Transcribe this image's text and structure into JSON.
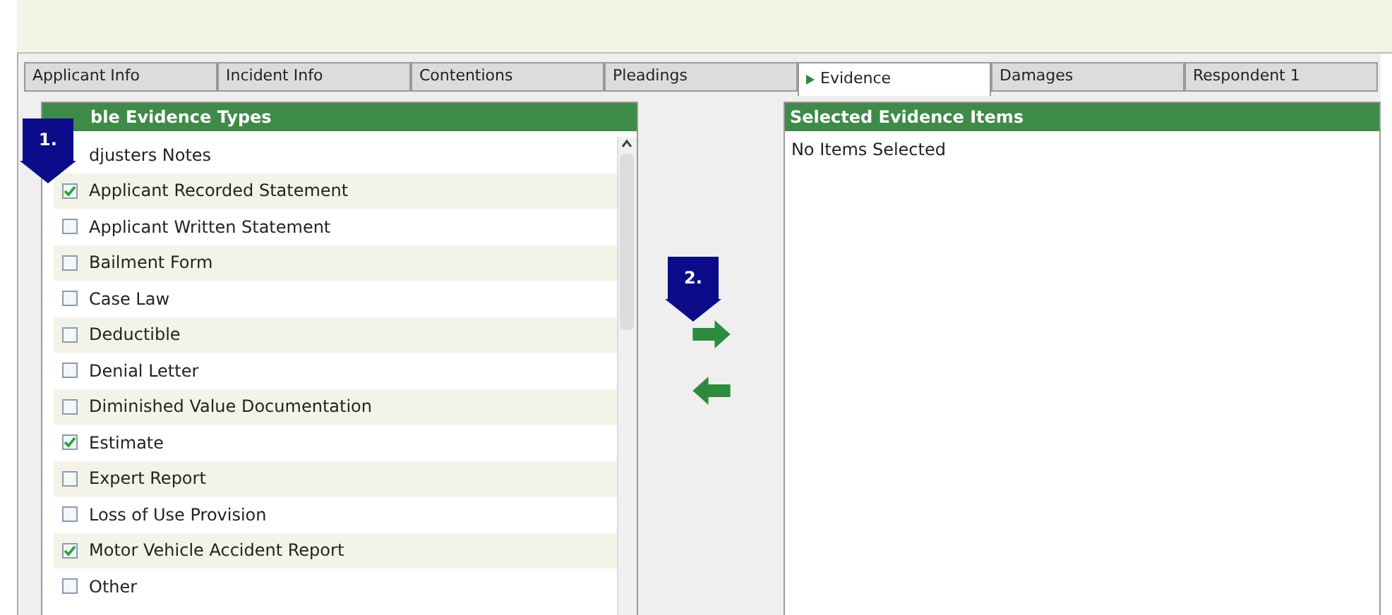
{
  "tabs": [
    {
      "label": "Applicant Info",
      "selected": false
    },
    {
      "label": "Incident Info",
      "selected": false
    },
    {
      "label": "Contentions",
      "selected": false
    },
    {
      "label": "Pleadings",
      "selected": false
    },
    {
      "label": "Evidence",
      "selected": true
    },
    {
      "label": "Damages",
      "selected": false
    },
    {
      "label": "Respondent 1",
      "selected": false
    }
  ],
  "available_panel": {
    "title": "ble Evidence Types",
    "items": [
      {
        "label": "djusters Notes"
      },
      {
        "label": "Applicant Recorded Statement",
        "checked": true
      },
      {
        "label": "Applicant Written Statement",
        "checked": false
      },
      {
        "label": "Bailment Form",
        "checked": false
      },
      {
        "label": "Case Law",
        "checked": false
      },
      {
        "label": "Deductible",
        "checked": false
      },
      {
        "label": "Denial Letter",
        "checked": false
      },
      {
        "label": "Diminished Value Documentation",
        "checked": false
      },
      {
        "label": "Estimate",
        "checked": true
      },
      {
        "label": "Expert Report",
        "checked": false
      },
      {
        "label": "Loss of Use Provision",
        "checked": false
      },
      {
        "label": "Motor Vehicle Accident Report",
        "checked": true
      },
      {
        "label": "Other",
        "checked": false
      }
    ]
  },
  "selected_panel": {
    "title": "Selected Evidence Items",
    "empty_text": "No Items Selected"
  },
  "callouts": [
    {
      "label": "1."
    },
    {
      "label": "2."
    }
  ]
}
